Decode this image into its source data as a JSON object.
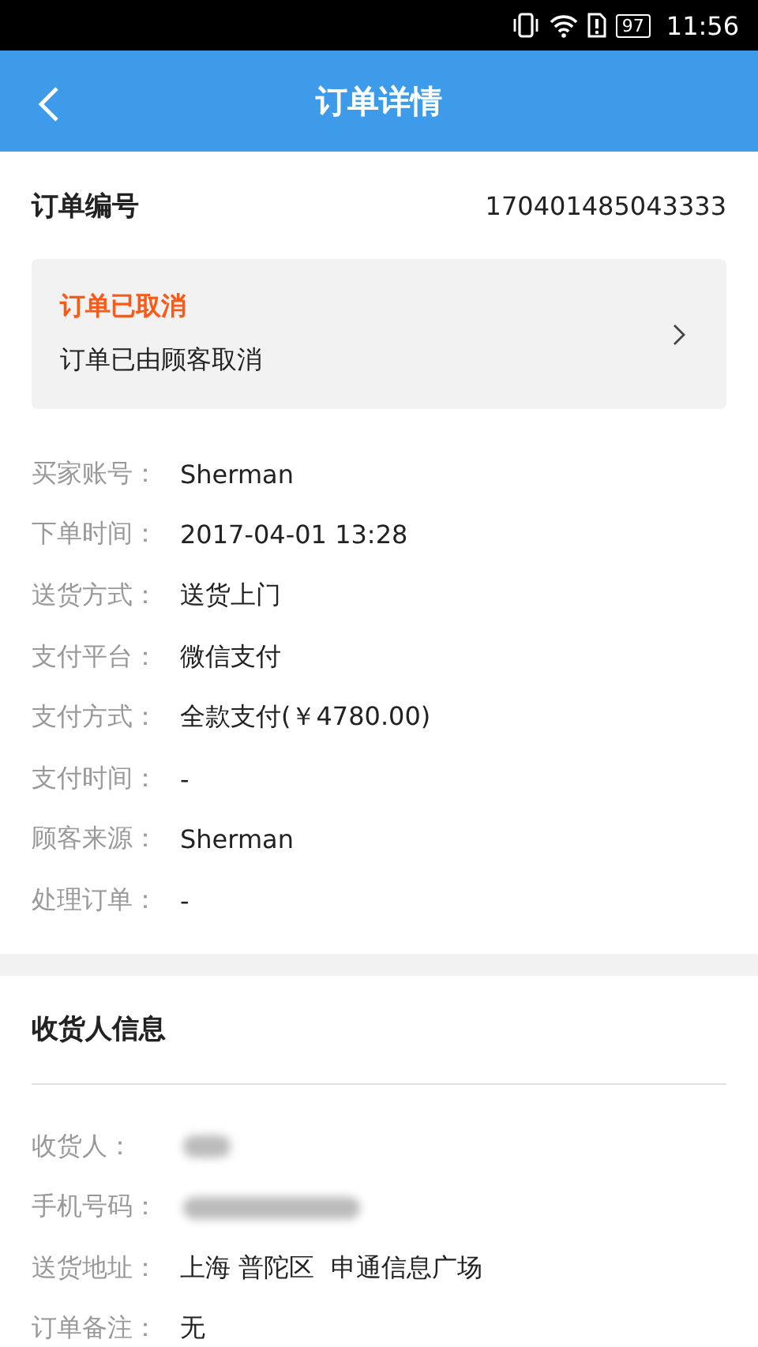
{
  "status_bar": {
    "battery": "97",
    "time": "11:56"
  },
  "header": {
    "title": "订单详情"
  },
  "order": {
    "label": "订单编号",
    "number": "170401485043333"
  },
  "status_card": {
    "status": "订单已取消",
    "detail": "订单已由顾客取消"
  },
  "details": [
    {
      "kind": "text",
      "label": "买家账号：",
      "value": "Sherman"
    },
    {
      "kind": "text",
      "label": "下单时间：",
      "value": "2017-04-01 13:28"
    },
    {
      "kind": "text",
      "label": "送货方式：",
      "value": "送货上门"
    },
    {
      "kind": "text",
      "label": "支付平台：",
      "value": "微信支付"
    },
    {
      "kind": "text",
      "label": "支付方式：",
      "value": "全款支付(￥4780.00)"
    },
    {
      "kind": "text",
      "label": "支付时间：",
      "value": "-"
    },
    {
      "kind": "text",
      "label": "顾客来源：",
      "value": "Sherman"
    },
    {
      "kind": "text",
      "label": "处理订单：",
      "value": "-"
    }
  ],
  "recipient": {
    "title": "收货人信息",
    "rows": [
      {
        "kind": "blurred",
        "label": "收货人："
      },
      {
        "kind": "blurred",
        "label": "手机号码："
      },
      {
        "kind": "text",
        "label": "送货地址：",
        "value": "上海 普陀区  申通信息广场"
      },
      {
        "kind": "text",
        "label": "订单备注：",
        "value": "无"
      }
    ]
  }
}
